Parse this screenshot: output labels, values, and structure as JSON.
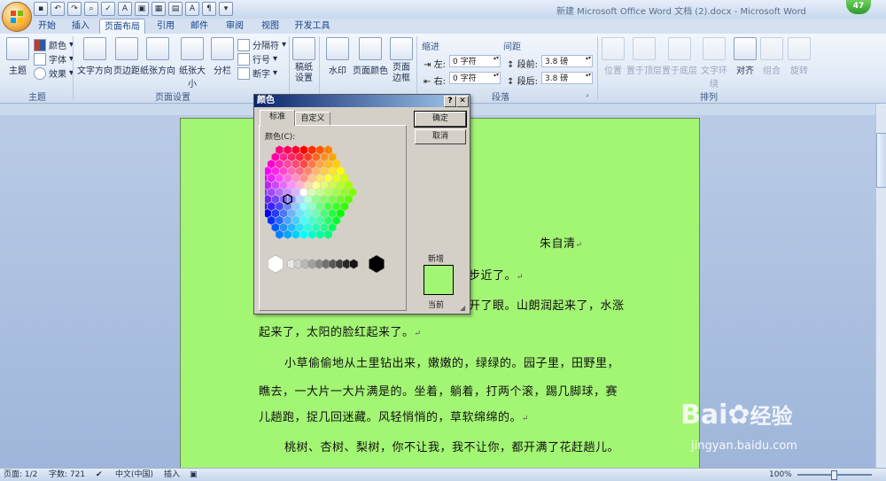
{
  "window": {
    "title": "新建 Microsoft Office Word 文档 (2).docx - Microsoft Word",
    "badge_count": "47"
  },
  "quick_access": [
    "save-icon",
    "undo-icon",
    "redo-icon",
    "print-preview-icon",
    "spelling-icon",
    "font-color-icon",
    "picture-icon",
    "table-icon",
    "chart-icon",
    "text-icon",
    "format-icon",
    "customize-icon"
  ],
  "tabs": [
    "开始",
    "插入",
    "页面布局",
    "引用",
    "邮件",
    "审阅",
    "视图",
    "开发工具"
  ],
  "active_tab": "页面布局",
  "ribbon": {
    "themes": {
      "label": "主题",
      "themes_btn": "主题",
      "colors": "颜色",
      "fonts": "字体",
      "effects": "效果"
    },
    "page_setup": {
      "label": "页面设置",
      "text_direction": "文字方向",
      "margins": "页边距",
      "orientation": "纸张方向",
      "size": "纸张大小",
      "columns": "分栏",
      "breaks": "分隔符",
      "line_numbers": "行号",
      "hyphenation": "断字"
    },
    "draft": {
      "label": "稿纸",
      "btn": "稿纸设置"
    },
    "page_background": {
      "watermark": "水印",
      "page_color": "页面颜色",
      "page_borders": "页面边框"
    },
    "paragraph": {
      "label": "段落",
      "indent": "缩进",
      "spacing": "间距",
      "left_label": "左:",
      "right_label": "右:",
      "before_label": "段前:",
      "after_label": "段后:",
      "left_value": "0 字符",
      "right_value": "0 字符",
      "before_value": "3.8 磅",
      "after_value": "3.8 磅"
    },
    "arrange": {
      "label": "排列",
      "position": "位置",
      "bring_front": "置于顶层",
      "send_back": "置于底层",
      "text_wrap": "文字环绕",
      "align": "对齐",
      "group": "组合",
      "rotate": "旋转"
    }
  },
  "document": {
    "author": "朱自清",
    "lines": [
      "步近了。",
      "开了眼。山朗润起来了，水涨",
      "起来了，太阳的脸红起来了。",
      "小草偷偷地从土里钻出来，嫩嫩的，绿绿的。园子里，田野里，",
      "瞧去，一大片一大片满是的。坐着，躺着，打两个滚，踢几脚球，赛",
      "儿趟跑，捉几回迷藏。风轻悄悄的，草软绵绵的。",
      "桃树、杏树、梨树，你不让我，我不让你，都开满了花赶趟儿。"
    ],
    "page_color": "#a3f574"
  },
  "color_dialog": {
    "title": "颜色",
    "tabs": [
      "标准",
      "自定义"
    ],
    "colors_label": "颜色(C):",
    "ok": "确定",
    "cancel": "取消",
    "new_label": "新增",
    "current_label": "当前",
    "selected_color": "#a3f574"
  },
  "status": {
    "page": "页面: 1/2",
    "words": "字数: 721",
    "language": "中文(中国)",
    "mode": "插入",
    "zoom": "100%"
  },
  "watermark": {
    "brand": "Bai",
    "brand_cn": "经验",
    "url": "jingyan.baidu.com"
  }
}
